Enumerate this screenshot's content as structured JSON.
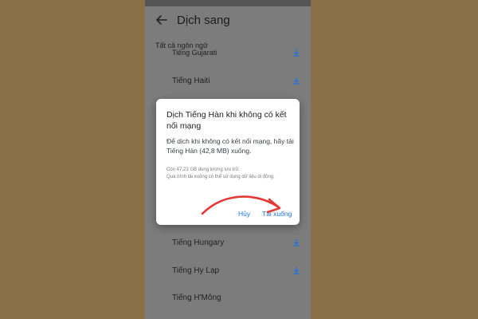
{
  "app": {
    "title": "Dịch sang",
    "back_icon": "arrow-left-icon"
  },
  "list": {
    "section_label": "Tất cả ngôn ngữ",
    "items": [
      {
        "label": "Tiếng Gujarati",
        "icon": "download-icon"
      },
      {
        "label": "Tiếng Haiti",
        "icon": "download-icon"
      },
      {
        "label": "Tiếng Hungary",
        "icon": "download-icon"
      },
      {
        "label": "Tiếng Hy Lạp",
        "icon": "download-icon"
      },
      {
        "label": "Tiếng H'Mông",
        "icon": ""
      }
    ]
  },
  "dialog": {
    "title": "Dịch Tiếng Hàn khi không có kết nối mạng",
    "body": "Để dịch khi không có kết nối mạng, hãy tải Tiếng Hàn (42,8 MB) xuống.",
    "storage_note": "Còn 47,23 GB dung lượng lưu trữ.",
    "data_note": "Quá trình tải xuống có thể sử dụng dữ liệu di động.",
    "cancel_label": "Hủy",
    "download_label": "Tải xuống"
  },
  "colors": {
    "background": "#8a7049",
    "accent": "#1a73e8",
    "annotation_arrow": "#e53935"
  }
}
